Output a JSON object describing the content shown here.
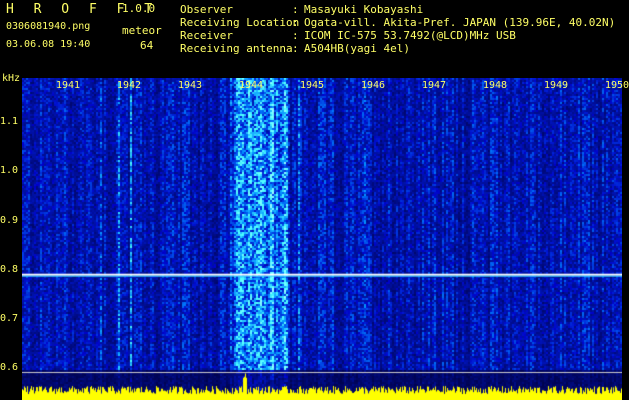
{
  "header": {
    "app_title": "H R O F F T",
    "version": "1.0.0",
    "filename": "0306081940.png",
    "mode": "meteor",
    "datetime": "03.06.08 19:40",
    "count": "64"
  },
  "info": [
    {
      "label": "Observer",
      "value": "Masayuki Kobayashi"
    },
    {
      "label": "Receiving Location",
      "value": "Ogata-vill. Akita-Pref. JAPAN (139.96E, 40.02N)"
    },
    {
      "label": "Receiver",
      "value": "ICOM IC-575 53.7492(@LCD)MHz USB"
    },
    {
      "label": "Receiving antenna",
      "value": "A504HB(yagi 4el)"
    }
  ],
  "chart_data": {
    "type": "heatmap",
    "ylabel": "kHz",
    "yticks": [
      "1.1",
      "1.0",
      "0.9",
      "0.8",
      "0.7",
      "0.6"
    ],
    "yrange": [
      0.58,
      1.19
    ],
    "xticks": [
      "1941",
      "1942",
      "1943",
      "1944",
      "1945",
      "1946",
      "1947",
      "1948",
      "1949",
      "1950"
    ],
    "carrier_khz": 0.79,
    "colors": {
      "background": "#000066",
      "signal": "#33ccff",
      "carrier": "#ffffff",
      "level_bar": "#ffff00"
    }
  }
}
